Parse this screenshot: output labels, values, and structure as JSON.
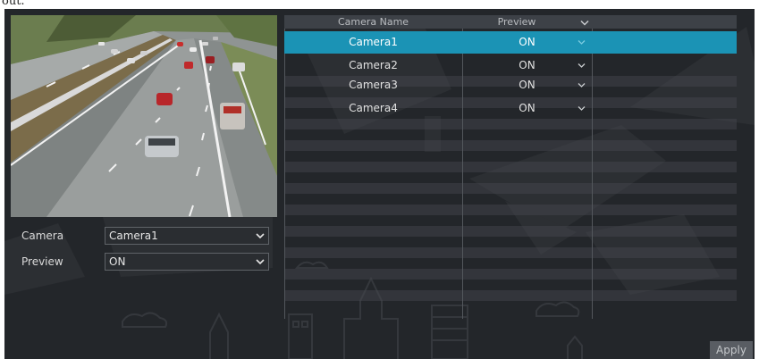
{
  "top_caption": "out.",
  "form": {
    "camera_label": "Camera",
    "camera_value": "Camera1",
    "preview_label": "Preview",
    "preview_value": "ON"
  },
  "table": {
    "headers": {
      "name": "Camera Name",
      "preview": "Preview"
    },
    "selected_row": 0,
    "rows": [
      {
        "name": "Camera1",
        "preview": "ON"
      },
      {
        "name": "Camera2",
        "preview": "ON"
      },
      {
        "name": "Camera3",
        "preview": "ON"
      },
      {
        "name": "Camera4",
        "preview": "ON"
      }
    ]
  },
  "apply_label": "Apply",
  "colors": {
    "panel_bg": "#23262a",
    "selection": "#1b93b5",
    "header_bg": "#3d4147"
  },
  "icons": {
    "dropdown": "chevron-down-icon",
    "preview_image": "highway-traffic-image"
  }
}
